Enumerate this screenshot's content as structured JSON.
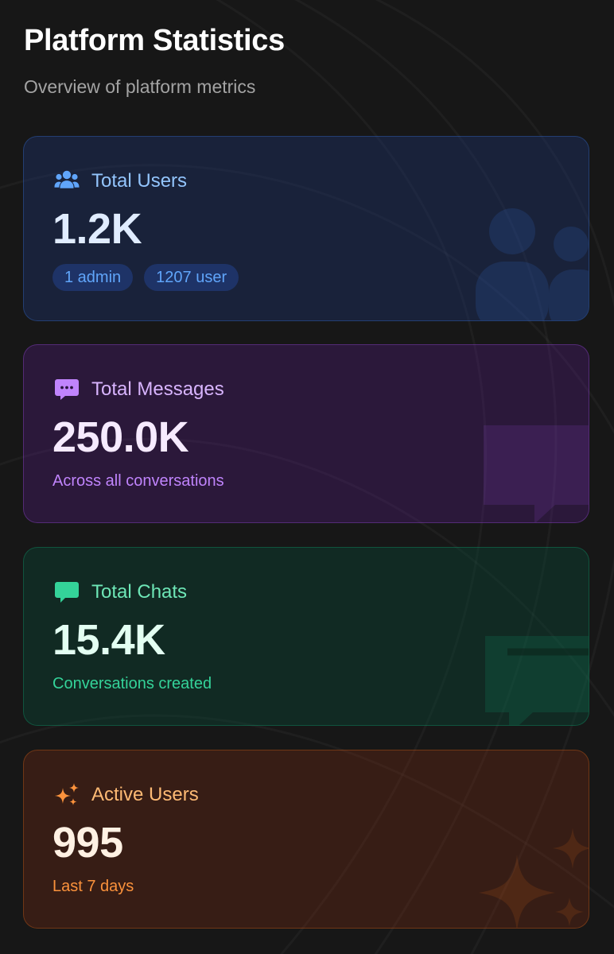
{
  "page": {
    "title": "Platform Statistics",
    "subtitle": "Overview of platform metrics"
  },
  "cards": [
    {
      "label": "Total Users",
      "value": "1.2K",
      "icon": "users-icon",
      "accent": "#60a5fa",
      "badges": [
        "1 admin",
        "1207 user"
      ]
    },
    {
      "label": "Total Messages",
      "value": "250.0K",
      "icon": "message-dots-icon",
      "accent": "#c084fc",
      "note": "Across all conversations"
    },
    {
      "label": "Total Chats",
      "value": "15.4K",
      "icon": "chat-bubble-icon",
      "accent": "#34d399",
      "note": "Conversations created"
    },
    {
      "label": "Active Users",
      "value": "995",
      "icon": "sparkles-icon",
      "accent": "#fb923c",
      "note": "Last 7 days"
    }
  ]
}
